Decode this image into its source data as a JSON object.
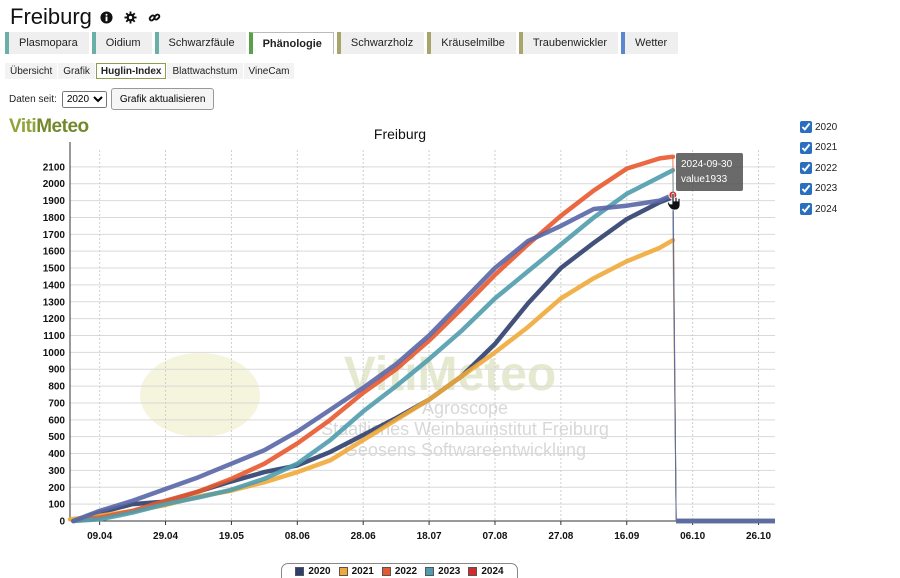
{
  "header": {
    "title": "Freiburg",
    "icons": [
      "info-icon",
      "gear-icon",
      "link-icon"
    ]
  },
  "main_tabs": [
    {
      "label": "Plasmopara",
      "color": "#6ab0a8",
      "active": false
    },
    {
      "label": "Oidium",
      "color": "#6ab0a8",
      "active": false
    },
    {
      "label": "Schwarzfäule",
      "color": "#6ab0a8",
      "active": false
    },
    {
      "label": "Phänologie",
      "color": "#5aa04a",
      "active": true
    },
    {
      "label": "Schwarzholz",
      "color": "#a7a56a",
      "active": false
    },
    {
      "label": "Kräuselmilbe",
      "color": "#a7a56a",
      "active": false
    },
    {
      "label": "Traubenwickler",
      "color": "#a7a56a",
      "active": false
    },
    {
      "label": "Wetter",
      "color": "#5a88cc",
      "active": false
    }
  ],
  "sub_tabs": [
    {
      "label": "Übersicht",
      "active": false
    },
    {
      "label": "Grafik",
      "active": false
    },
    {
      "label": "Huglin-Index",
      "active": true
    },
    {
      "label": "Blattwachstum",
      "active": false
    },
    {
      "label": "VineCam",
      "active": false
    }
  ],
  "controls": {
    "since_label": "Daten seit:",
    "year_value": "2020",
    "refresh_label": "Grafik aktualisieren"
  },
  "logo": {
    "part1": "Viti",
    "part2": "Meteo"
  },
  "watermark": {
    "line1": "VitiMeteo",
    "line2": "Agroscope",
    "line3": "Staatliches Weinbauinstitut Freiburg",
    "line4": "Geosens Softwareentwicklung"
  },
  "tooltip": {
    "date": "2024-09-30",
    "value": "value1933"
  },
  "series_toggles": [
    {
      "label": "2020",
      "checked": true
    },
    {
      "label": "2021",
      "checked": true
    },
    {
      "label": "2022",
      "checked": true
    },
    {
      "label": "2023",
      "checked": true
    },
    {
      "label": "2024",
      "checked": true
    }
  ],
  "chart_data": {
    "type": "line",
    "title": "Freiburg",
    "xlabel": "",
    "ylabel": "",
    "x_range": [
      "2024-03-31",
      "2024-10-31"
    ],
    "ylim": [
      0,
      2200
    ],
    "y_ticks": [
      0,
      100,
      200,
      300,
      400,
      500,
      600,
      700,
      800,
      900,
      1000,
      1100,
      1200,
      1300,
      1400,
      1500,
      1600,
      1700,
      1800,
      1900,
      2000,
      2100
    ],
    "x_ticks": [
      "09.04",
      "29.04",
      "19.05",
      "08.06",
      "28.06",
      "18.07",
      "07.08",
      "27.08",
      "16.09",
      "06.10",
      "26.10"
    ],
    "x_tick_dates": [
      "2024-04-09",
      "2024-04-29",
      "2024-05-19",
      "2024-06-08",
      "2024-06-28",
      "2024-07-18",
      "2024-08-07",
      "2024-08-27",
      "2024-09-16",
      "2024-10-06",
      "2024-10-26"
    ],
    "grid": true,
    "legend_position": "bottom",
    "series": [
      {
        "name": "2020",
        "color": "#2e3f6e",
        "points": [
          [
            "2024-04-01",
            0
          ],
          [
            "2024-04-09",
            50
          ],
          [
            "2024-04-19",
            100
          ],
          [
            "2024-04-29",
            115
          ],
          [
            "2024-05-09",
            175
          ],
          [
            "2024-05-19",
            235
          ],
          [
            "2024-05-29",
            290
          ],
          [
            "2024-06-08",
            330
          ],
          [
            "2024-06-18",
            410
          ],
          [
            "2024-06-28",
            510
          ],
          [
            "2024-07-08",
            610
          ],
          [
            "2024-07-18",
            720
          ],
          [
            "2024-07-28",
            860
          ],
          [
            "2024-08-07",
            1050
          ],
          [
            "2024-08-17",
            1290
          ],
          [
            "2024-08-27",
            1500
          ],
          [
            "2024-09-06",
            1650
          ],
          [
            "2024-09-16",
            1790
          ],
          [
            "2024-09-26",
            1890
          ],
          [
            "2024-09-30",
            1920
          ],
          [
            "2024-10-01",
            0
          ],
          [
            "2024-10-31",
            0
          ]
        ]
      },
      {
        "name": "2021",
        "color": "#f0a838",
        "points": [
          [
            "2024-03-31",
            10
          ],
          [
            "2024-04-09",
            30
          ],
          [
            "2024-04-19",
            60
          ],
          [
            "2024-04-29",
            95
          ],
          [
            "2024-05-09",
            145
          ],
          [
            "2024-05-19",
            180
          ],
          [
            "2024-05-29",
            230
          ],
          [
            "2024-06-08",
            290
          ],
          [
            "2024-06-18",
            360
          ],
          [
            "2024-06-28",
            480
          ],
          [
            "2024-07-08",
            600
          ],
          [
            "2024-07-18",
            720
          ],
          [
            "2024-07-28",
            860
          ],
          [
            "2024-08-07",
            1000
          ],
          [
            "2024-08-17",
            1150
          ],
          [
            "2024-08-27",
            1320
          ],
          [
            "2024-09-06",
            1440
          ],
          [
            "2024-09-16",
            1540
          ],
          [
            "2024-09-26",
            1620
          ],
          [
            "2024-09-30",
            1665
          ],
          [
            "2024-10-01",
            0
          ],
          [
            "2024-10-31",
            0
          ]
        ]
      },
      {
        "name": "2022",
        "color": "#e8582e",
        "points": [
          [
            "2024-04-01",
            0
          ],
          [
            "2024-04-09",
            20
          ],
          [
            "2024-04-19",
            60
          ],
          [
            "2024-04-29",
            120
          ],
          [
            "2024-05-09",
            175
          ],
          [
            "2024-05-19",
            250
          ],
          [
            "2024-05-29",
            340
          ],
          [
            "2024-06-08",
            460
          ],
          [
            "2024-06-18",
            600
          ],
          [
            "2024-06-28",
            760
          ],
          [
            "2024-07-08",
            900
          ],
          [
            "2024-07-18",
            1070
          ],
          [
            "2024-07-28",
            1260
          ],
          [
            "2024-08-07",
            1460
          ],
          [
            "2024-08-17",
            1640
          ],
          [
            "2024-08-27",
            1810
          ],
          [
            "2024-09-06",
            1960
          ],
          [
            "2024-09-16",
            2090
          ],
          [
            "2024-09-26",
            2150
          ],
          [
            "2024-09-30",
            2160
          ],
          [
            "2024-10-01",
            0
          ],
          [
            "2024-10-31",
            0
          ]
        ]
      },
      {
        "name": "2023",
        "color": "#4f9cad",
        "points": [
          [
            "2024-04-01",
            0
          ],
          [
            "2024-04-09",
            10
          ],
          [
            "2024-04-19",
            50
          ],
          [
            "2024-04-29",
            100
          ],
          [
            "2024-05-09",
            140
          ],
          [
            "2024-05-19",
            185
          ],
          [
            "2024-05-29",
            250
          ],
          [
            "2024-06-08",
            340
          ],
          [
            "2024-06-18",
            480
          ],
          [
            "2024-06-28",
            650
          ],
          [
            "2024-07-08",
            800
          ],
          [
            "2024-07-18",
            960
          ],
          [
            "2024-07-28",
            1130
          ],
          [
            "2024-08-07",
            1320
          ],
          [
            "2024-08-17",
            1480
          ],
          [
            "2024-08-27",
            1640
          ],
          [
            "2024-09-06",
            1800
          ],
          [
            "2024-09-16",
            1940
          ],
          [
            "2024-09-26",
            2040
          ],
          [
            "2024-09-30",
            2080
          ],
          [
            "2024-10-01",
            0
          ],
          [
            "2024-10-31",
            0
          ]
        ]
      },
      {
        "name": "2024",
        "color": "#5966a6",
        "points": [
          [
            "2024-04-01",
            0
          ],
          [
            "2024-04-09",
            60
          ],
          [
            "2024-04-19",
            120
          ],
          [
            "2024-04-29",
            190
          ],
          [
            "2024-05-09",
            260
          ],
          [
            "2024-05-19",
            340
          ],
          [
            "2024-05-29",
            420
          ],
          [
            "2024-06-08",
            530
          ],
          [
            "2024-06-18",
            660
          ],
          [
            "2024-06-28",
            790
          ],
          [
            "2024-07-08",
            930
          ],
          [
            "2024-07-18",
            1100
          ],
          [
            "2024-07-28",
            1300
          ],
          [
            "2024-08-07",
            1500
          ],
          [
            "2024-08-17",
            1660
          ],
          [
            "2024-08-27",
            1750
          ],
          [
            "2024-09-06",
            1850
          ],
          [
            "2024-09-16",
            1870
          ],
          [
            "2024-09-26",
            1900
          ],
          [
            "2024-09-30",
            1933
          ],
          [
            "2024-10-01",
            0
          ],
          [
            "2024-10-31",
            0
          ]
        ]
      }
    ],
    "legend": [
      {
        "label": "2020",
        "color": "#2e3f6e"
      },
      {
        "label": "2021",
        "color": "#f0a838"
      },
      {
        "label": "2022",
        "color": "#e8582e"
      },
      {
        "label": "2023",
        "color": "#4f9cad"
      },
      {
        "label": "2024",
        "color": "#d42a2a"
      }
    ],
    "highlight": {
      "date": "2024-09-30",
      "value": 1933,
      "color": "#d42a2a"
    }
  }
}
